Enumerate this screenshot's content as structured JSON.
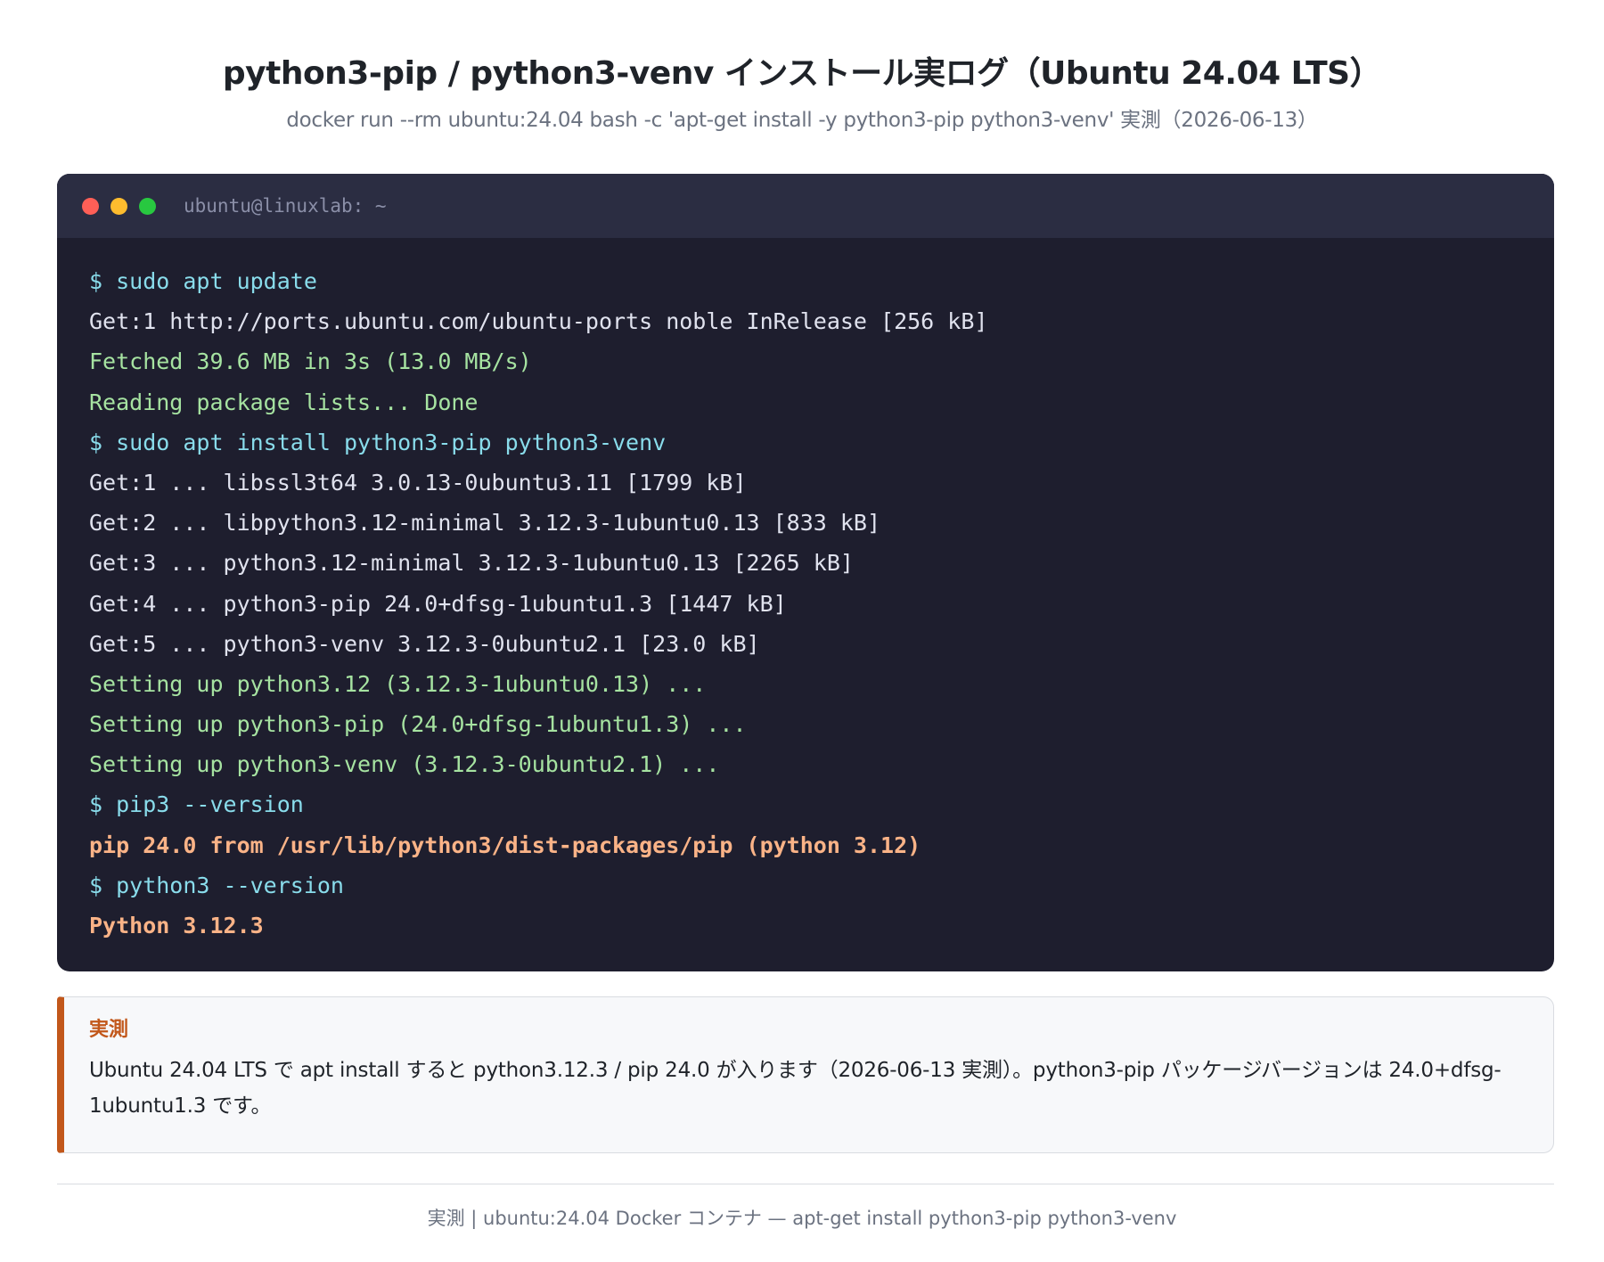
{
  "header": {
    "title": "python3-pip / python3-venv インストール実ログ（Ubuntu 24.04 LTS）",
    "subtitle": "docker run --rm ubuntu:24.04 bash -c 'apt-get install -y python3-pip python3-venv' 実測（2026-06-13）"
  },
  "terminal": {
    "title": "ubuntu@linuxlab: ~",
    "lines": [
      {
        "type": "cmd",
        "text": "$ sudo apt update"
      },
      {
        "type": "out",
        "text": "Get:1 http://ports.ubuntu.com/ubuntu-ports noble InRelease [256 kB]"
      },
      {
        "type": "ok",
        "text": "Fetched 39.6 MB in 3s (13.0 MB/s)"
      },
      {
        "type": "ok",
        "text": "Reading package lists... Done"
      },
      {
        "type": "cmd",
        "text": "$ sudo apt install python3-pip python3-venv"
      },
      {
        "type": "out",
        "text": "Get:1 ... libssl3t64 3.0.13-0ubuntu3.11 [1799 kB]"
      },
      {
        "type": "out",
        "text": "Get:2 ... libpython3.12-minimal 3.12.3-1ubuntu0.13 [833 kB]"
      },
      {
        "type": "out",
        "text": "Get:3 ... python3.12-minimal 3.12.3-1ubuntu0.13 [2265 kB]"
      },
      {
        "type": "out",
        "text": "Get:4 ... python3-pip 24.0+dfsg-1ubuntu1.3 [1447 kB]"
      },
      {
        "type": "out",
        "text": "Get:5 ... python3-venv 3.12.3-0ubuntu2.1 [23.0 kB]"
      },
      {
        "type": "ok",
        "text": "Setting up python3.12 (3.12.3-1ubuntu0.13) ..."
      },
      {
        "type": "ok",
        "text": "Setting up python3-pip (24.0+dfsg-1ubuntu1.3) ..."
      },
      {
        "type": "ok",
        "text": "Setting up python3-venv (3.12.3-0ubuntu2.1) ..."
      },
      {
        "type": "cmd",
        "text": "$ pip3 --version"
      },
      {
        "type": "hl",
        "text": "pip 24.0 from /usr/lib/python3/dist-packages/pip (python 3.12)"
      },
      {
        "type": "cmd",
        "text": "$ python3 --version"
      },
      {
        "type": "hl",
        "text": "Python 3.12.3"
      }
    ]
  },
  "note": {
    "label": "実測",
    "text": "Ubuntu 24.04 LTS で apt install すると python3.12.3 / pip 24.0 が入ります（2026-06-13 実測）。python3-pip パッケージバージョンは 24.0+dfsg-1ubuntu1.3 です。"
  },
  "footer": {
    "text": "実測 | ubuntu:24.04 Docker コンテナ — apt-get install python3-pip python3-venv"
  },
  "colors": {
    "terminal_bg": "#1e1e2e",
    "terminal_bar": "#2b2d42",
    "command": "#89dceb",
    "output": "#e0e2ee",
    "success": "#a6e3a1",
    "highlight": "#fab387",
    "accent": "#c2571a"
  }
}
